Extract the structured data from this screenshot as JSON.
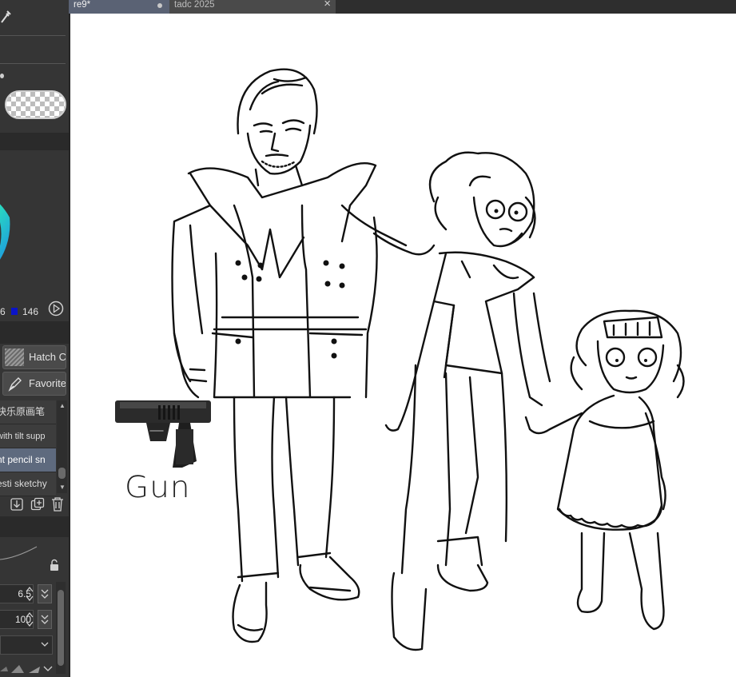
{
  "tabs": [
    {
      "label": "re9*",
      "active": true,
      "status_icon": "unsaved-dot"
    },
    {
      "label": "tadc 2025",
      "active": false,
      "close_icon": "close"
    }
  ],
  "color_panel": {
    "values": [
      "6",
      "146"
    ],
    "blue_swatch": "#0a14c8"
  },
  "brush_buttons": {
    "hatch": "Hatch C",
    "favorite": "Favorite"
  },
  "brush_list": [
    {
      "label": "快乐原画笔",
      "selected": false
    },
    {
      "label": "with tilt supp",
      "selected": false
    },
    {
      "label": "nt pencil sn",
      "selected": true
    },
    {
      "label": "esti sketchy",
      "selected": false
    }
  ],
  "tool_property": {
    "brush_size": "6.5",
    "opacity": "100"
  },
  "canvas": {
    "annotation": "Gun"
  },
  "colors": {
    "accent": "#5e6a7e",
    "panel": "#353535",
    "canvas": "#ffffff"
  }
}
